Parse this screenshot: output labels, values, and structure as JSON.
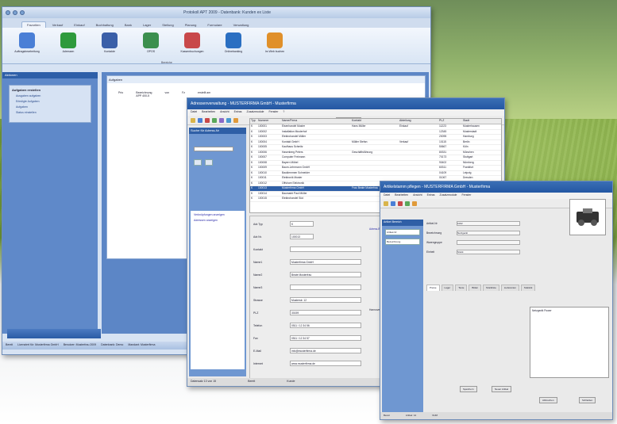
{
  "main_window": {
    "title": "Protokoll APT 2009 - Datenbank: Kunden ex Liste",
    "ribbon_tabs": [
      "Favoriten",
      "Verkauf",
      "Einkauf",
      "Buchhaltung",
      "Bank",
      "Lager",
      "Stellung",
      "Planung",
      "Formulare",
      "Verwaltung"
    ],
    "ribbon_buttons": [
      {
        "label": "Auftragsbearbeitung",
        "icon": "document-edit-icon",
        "color": "#4a7fd6"
      },
      {
        "label": "Adressen",
        "icon": "people-icon",
        "color": "#2e9a3c"
      },
      {
        "label": "Kontakte",
        "icon": "person-icon",
        "color": "#3a5fa8"
      },
      {
        "label": "OPOS",
        "icon": "money-icon",
        "color": "#3b8f4e"
      },
      {
        "label": "Kassenbuchungen",
        "icon": "books-icon",
        "color": "#c8484a"
      },
      {
        "label": "Onlinebanking",
        "icon": "bank-icon",
        "color": "#2a6fc2"
      },
      {
        "label": "Im Web buchen",
        "icon": "globe-icon",
        "color": "#e0902a"
      }
    ],
    "ribbon_group": "Bereiche",
    "nav_header": "Aktionen",
    "nav_box_title": "Aufgaben erstellen",
    "nav_items": [
      "Ausgaben aufgaben",
      "Erledigte Aufgaben",
      "Aufgaben",
      "Status einstellen"
    ],
    "doc_header": "Aufgaben",
    "doc_columns": [
      "Prio",
      "Bezeichnung",
      "von",
      "Fz",
      "erstellt am"
    ],
    "doc_rows": [
      [
        "",
        "APP 400-5",
        "",
        "",
        ""
      ]
    ],
    "status": [
      "Bereit",
      "Lizenziert für: Musterfirma GmbH",
      "Benutzer: Musterfrau 2009",
      "Datenbank: Demo",
      "Mandant: Musterfirma"
    ]
  },
  "middle_window": {
    "title": "Adressenverwaltung - MUSTERFIRMA GmbH - Musterfirma",
    "menu": [
      "Datei",
      "Bearbeiten",
      "Ansicht",
      "Extras",
      "Zusatzmodule",
      "Fenster",
      "?"
    ],
    "search_label": "Suche für Adress-Nr",
    "search_combo": "Musterfirm",
    "grid_headers": [
      "Typ",
      "Nummer",
      "Name/Firma",
      "Kontakt",
      "Abteilung",
      "PLZ",
      "Stadt"
    ],
    "grid_rows": [
      [
        "K",
        "100001",
        "Eisenhandel Muster",
        "Hans Müller",
        "Einkauf",
        "11223",
        "Musterhausen"
      ],
      [
        "K",
        "100002",
        "Installation Musterhof",
        "",
        "",
        "12345",
        "Musterstadt"
      ],
      [
        "K",
        "100003",
        "Elektrohandel Müller",
        "",
        "",
        "20095",
        "Hamburg"
      ],
      [
        "K",
        "100004",
        "Kontakt GmbH",
        "Müller Stefan",
        "Verkauf",
        "10115",
        "Berlin"
      ],
      [
        "K",
        "100005",
        "Kaufhaus Schmitz",
        "",
        "",
        "50667",
        "Köln"
      ],
      [
        "K",
        "100006",
        "Hasenberg Peters",
        "Geschäftsführung",
        "",
        "80331",
        "München"
      ],
      [
        "K",
        "100007",
        "Computer Freimann",
        "",
        "",
        "70173",
        "Stuttgart"
      ],
      [
        "K",
        "100008",
        "Bayern Möbel",
        "",
        "",
        "90402",
        "Nürnberg"
      ],
      [
        "K",
        "100009",
        "Baum-Lehrmann GmbH",
        "",
        "",
        "60311",
        "Frankfurt"
      ],
      [
        "K",
        "100010",
        "Bauklemmen Schneider",
        "",
        "",
        "04109",
        "Leipzig"
      ],
      [
        "K",
        "100011",
        "Elektronik Muster",
        "",
        "",
        "01067",
        "Dresden"
      ],
      [
        "K",
        "100012",
        "Offshore Elektronik",
        "",
        "",
        "28195",
        "Bremen"
      ],
      [
        "K",
        "100013",
        "Musterfirma GmbH",
        "Frau Beate Musterfrau",
        "",
        "30159",
        "Hannover"
      ],
      [
        "K",
        "100014",
        "Baumarkt Paul Müller",
        "",
        "",
        "40213",
        "Düsseldorf"
      ],
      [
        "K",
        "100015",
        "Elektrohandel Süd",
        "",
        "",
        "45127",
        "Essen"
      ]
    ],
    "left_links": [
      "Verknüpfungen anzeigen",
      "Adressen anzeigen"
    ],
    "form": [
      {
        "label": "Adr.Typ",
        "value": "K"
      },
      {
        "label": "Adr.Nr.",
        "value": "100013"
      },
      {
        "label": "Kontakt",
        "value": ""
      },
      {
        "label": "Name1",
        "value": "Musterfirma GmbH"
      },
      {
        "label": "Name2",
        "value": "Beate Musterfrau"
      },
      {
        "label": "Name3",
        "value": ""
      },
      {
        "label": "Strasse",
        "value": "Musterstr. 12"
      },
      {
        "label": "PLZ",
        "value": "30159"
      },
      {
        "label": "Telefon",
        "value": "0511 / 12 34 56"
      },
      {
        "label": "Fax",
        "value": "0511 / 12 34 57"
      },
      {
        "label": "E-Mail",
        "value": "info@musterfirma.de"
      },
      {
        "label": "Internet",
        "value": "www.musterfirma.de"
      }
    ],
    "form_link": "Adress-Bild Nr.1",
    "form_city": "Hannover",
    "status": [
      "Datensatz 13 von 15",
      "Bereit",
      "Kunde"
    ]
  },
  "front_window": {
    "title": "Artikelstamm pflegen - MUSTERFIRMA GmbH - Musterfirma",
    "menu": [
      "Datei",
      "Bearbeiten",
      "Ansicht",
      "Extras",
      "Zusatzmodule",
      "Fenster"
    ],
    "left_header": "Artikel Bereich",
    "left_buttons": [
      "Artikel-Nr",
      "Bezeichnung"
    ],
    "form": [
      {
        "label": "Artikel-Nr",
        "value": "1002"
      },
      {
        "label": "Bezeichnung",
        "value": "Netzgerät"
      },
      {
        "label": "Warengruppe",
        "value": ""
      },
      {
        "label": "Einheit",
        "value": "Stück"
      }
    ],
    "tabs": [
      "Preise",
      "Lager",
      "Texte",
      "Bilder",
      "Stückliste",
      "Lieferanten",
      "Statistik"
    ],
    "list_item": "Netzgerät Power",
    "buttons": [
      "Speichern",
      "Neuer Artikel",
      "Abbrechen",
      "Schließen"
    ],
    "status": [
      "Bereit",
      "Artikel: 12",
      "NUM"
    ]
  }
}
